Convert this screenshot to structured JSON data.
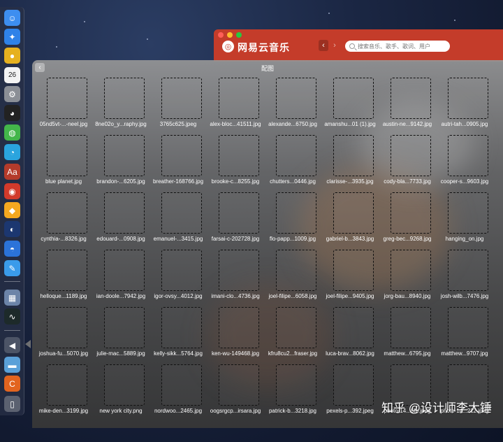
{
  "dock": {
    "items": [
      {
        "icon": "finder-icon",
        "glyph": "☺",
        "bg": "#3d8ef0"
      },
      {
        "icon": "safari-icon",
        "glyph": "✦",
        "bg": "#2f82e8"
      },
      {
        "icon": "chrome-icon",
        "glyph": "●",
        "bg": "#e6b11f"
      },
      {
        "icon": "calendar-icon",
        "glyph": "26",
        "bg": "#f3f3f3"
      },
      {
        "icon": "system-preferences-icon",
        "glyph": "⚙",
        "bg": "#8b8f96"
      },
      {
        "icon": "qq-icon",
        "glyph": "◕",
        "bg": "#222"
      },
      {
        "icon": "wechat-icon",
        "glyph": "◍",
        "bg": "#43b64a"
      },
      {
        "icon": "qq-browser-icon",
        "glyph": "◔",
        "bg": "#2aa4de"
      },
      {
        "icon": "dictionary-icon",
        "glyph": "Aa",
        "bg": "#b43b2b"
      },
      {
        "icon": "netease-music-icon",
        "glyph": "◉",
        "bg": "#d23a2b"
      },
      {
        "icon": "sketch-icon",
        "glyph": "◆",
        "bg": "#f4a820"
      },
      {
        "icon": "cinema4d-icon",
        "glyph": "◐",
        "bg": "#1c3770"
      },
      {
        "icon": "pixelmator-icon",
        "glyph": "◓",
        "bg": "#2b73d9"
      },
      {
        "icon": "xmind-icon",
        "glyph": "✎",
        "bg": "#3a9bea"
      },
      {
        "icon": "preview-icon",
        "glyph": "▦",
        "bg": "#6c84a8"
      },
      {
        "icon": "activity-monitor-icon",
        "glyph": "∿",
        "bg": "#1d2a2a"
      },
      {
        "icon": "back-arrow-icon",
        "glyph": "◀",
        "bg": "#4c5466"
      },
      {
        "icon": "folder-icon",
        "glyph": "▬",
        "bg": "#5aa0d8"
      },
      {
        "icon": "cleaner-icon",
        "glyph": "C",
        "bg": "#e2641f"
      },
      {
        "icon": "trash-icon",
        "glyph": "▯",
        "bg": "#5b6170"
      }
    ]
  },
  "netease": {
    "title": "网易云音乐",
    "logo_glyph": "◎",
    "back_glyph": "‹",
    "forward_glyph": "›",
    "search_placeholder": "搜索音乐、歌手、歌词、用户"
  },
  "folder": {
    "title": "配图",
    "back_glyph": "‹",
    "files": [
      "05nd5vt-...-neel.jpg",
      "8ne02o_y...raphy.jpg",
      "3765c625.jpeg",
      "alex-bloc...41511.jpg",
      "alexande...6750.jpg",
      "amanshu...01 (1).jpg",
      "austin-ne...9142.jpg",
      "autri-tah...0905.jpg",
      "blue planet.jpg",
      "brandon-...6205.jpg",
      "breather-168766.jpg",
      "brooke-c...8255.jpg",
      "chutters...0446.jpg",
      "clarisse-...3935.jpg",
      "cody-bla...7733.jpg",
      "cooper-s...9603.jpg",
      "cynthia-...8326.jpg",
      "edouard-...0908.jpg",
      "emanuel-...3415.jpg",
      "farsai-c-202728.jpg",
      "flo-papp...1009.jpg",
      "gabriel-b...3843.jpg",
      "greg-bec...9268.jpg",
      "hanging_on.jpg",
      "helloque...1189.jpg",
      "ian-doole...7942.jpg",
      "igor-ovsy...4012.jpg",
      "imani-clo...4736.jpg",
      "joel-filipe...6058.jpg",
      "joel-filipe...9405.jpg",
      "jorg-bau...8940.jpg",
      "josh-wilb...7476.jpg",
      "joshua-fu...5070.jpg",
      "julie-mac...5889.jpg",
      "kelly-sikk...5764.jpg",
      "ken-wu-149468.jpg",
      "kfru8cu2...fraser.jpg",
      "luca-brav...8062.jpg",
      "matthew...6795.jpg",
      "matthew...9707.jpg",
      "mike-den...3199.jpg",
      "new york city.png",
      "nordwoo...2465.jpg",
      "oogsrgcp...irsara.jpg",
      "patrick-b...3218.jpg",
      "pexels-p...392.jpeg",
      "photo-14...6fb.jpeg",
      "photo-14...212.jpeg"
    ]
  },
  "watermark": "知乎 @设计师李大锤"
}
